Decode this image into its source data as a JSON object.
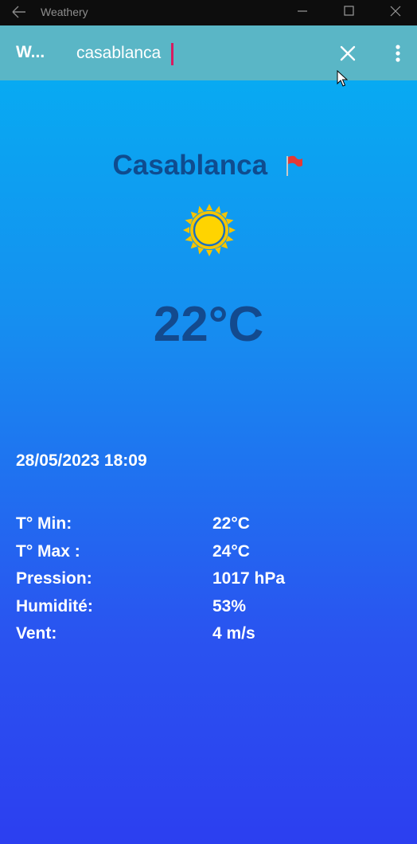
{
  "window": {
    "title": "Weathery",
    "back_icon": "arrow-left-icon",
    "minimize_icon": "minimize-icon",
    "maximize_icon": "maximize-icon",
    "close_icon": "close-icon"
  },
  "appbar": {
    "title": "W...",
    "search_value": "casablanca",
    "clear_icon": "close-icon",
    "menu_icon": "more-vertical-icon",
    "color": "#5ab6c6"
  },
  "weather": {
    "city": "Casablanca",
    "flag_icon": "red-flag-icon",
    "condition_icon": "sun-icon",
    "temperature": "22°C",
    "datetime": "28/05/2023 18:09"
  },
  "details": [
    {
      "label": "T° Min:",
      "value": "22°C"
    },
    {
      "label": "T° Max :",
      "value": "24°C"
    },
    {
      "label": "Pression:",
      "value": "1017 hPa"
    },
    {
      "label": "Humidité:",
      "value": "53%"
    },
    {
      "label": "Vent:",
      "value": "4 m/s"
    }
  ],
  "colors": {
    "gradient_top": "#05b0f2",
    "gradient_bottom": "#2c3ff0",
    "city_text": "#0f4c8f",
    "caret": "#d81b60"
  }
}
